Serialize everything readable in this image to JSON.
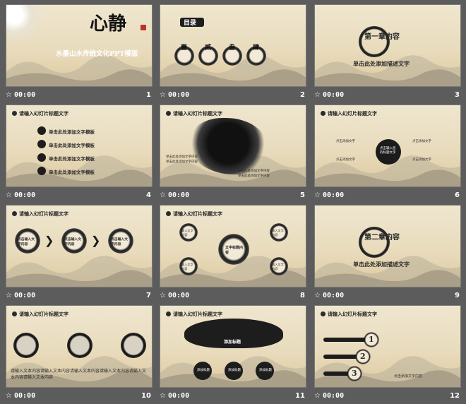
{
  "colors": {
    "background": "#5c5c5c",
    "paper": "#ebdfc3",
    "ink": "#1c1c1c",
    "mountain": "#a9a28e",
    "accent_red": "#b8342a"
  },
  "slides": [
    {
      "number": "1",
      "duration": "00:00",
      "title_big": "心静",
      "subtitle": "水墨山水传统文化PPT模版"
    },
    {
      "number": "2",
      "duration": "00:00",
      "label": "目录",
      "items": [
        "壹",
        "贰",
        "叁",
        "肆"
      ]
    },
    {
      "number": "3",
      "duration": "00:00",
      "heading": "第一章内容",
      "subheading": "单击此处添加描述文字"
    },
    {
      "number": "4",
      "duration": "00:00",
      "title": "请输入幻灯片标题文字",
      "items": [
        "单击此处添加文字模板",
        "单击此处添加文字模板",
        "单击此处添加文字模板",
        "单击此处添加文字模板"
      ]
    },
    {
      "number": "5",
      "duration": "00:00",
      "title": "请输入幻灯片标题文字",
      "items": [
        "单击此处添加文字内容",
        "单击此处添加文字内容",
        "单击此处添加文字内容",
        "单击此处添加文字内容"
      ]
    },
    {
      "number": "6",
      "duration": "00:00",
      "title": "请输入幻灯片标题文字",
      "center": "点击输入您的标题文字",
      "items": [
        "点击添加文字",
        "点击添加文字",
        "点击添加文字",
        "点击添加文字"
      ]
    },
    {
      "number": "7",
      "duration": "00:00",
      "title": "请输入幻灯片标题文字",
      "items": [
        "点击输入文字内容",
        "点击输入文字内容",
        "点击输入文字内容"
      ]
    },
    {
      "number": "8",
      "duration": "00:00",
      "title": "请输入幻灯片标题文字",
      "center": "文字标题内容",
      "items": [
        "输入文字内容",
        "输入文字内容",
        "输入文字内容",
        "输入文字内容"
      ]
    },
    {
      "number": "9",
      "duration": "00:00",
      "heading": "第二章内容",
      "subheading": "单击此处添加描述文字"
    },
    {
      "number": "10",
      "duration": "00:00",
      "title": "请输入幻灯片标题文字",
      "body": "请输入文本内容请输入文本内容请输入文本内容请输入文本内容请输入文本内容请输入文本内容"
    },
    {
      "number": "11",
      "duration": "00:00",
      "title": "请输入幻灯片标题文字",
      "center": "添加标题",
      "items": [
        "添加标题",
        "添加标题",
        "添加标题"
      ]
    },
    {
      "number": "12",
      "duration": "00:00",
      "title": "请输入幻灯片标题文字",
      "items": [
        "1",
        "2",
        "3"
      ],
      "caption": "点击添加文字内容"
    }
  ]
}
